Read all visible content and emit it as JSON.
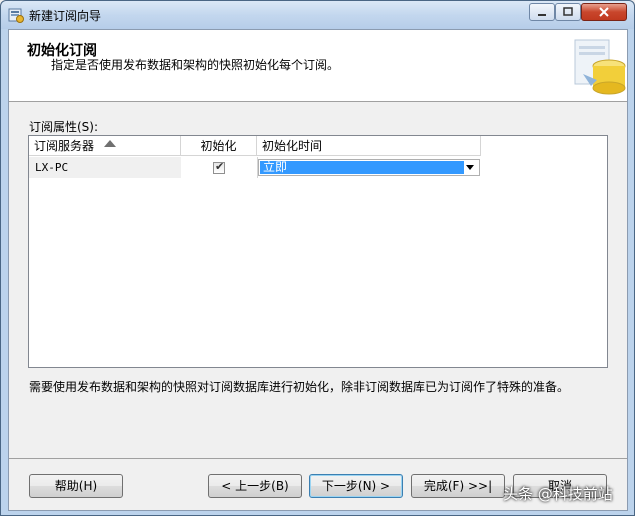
{
  "window": {
    "title": "新建订阅向导"
  },
  "header": {
    "title": "初始化订阅",
    "subtitle": "指定是否使用发布数据和架构的快照初始化每个订阅。"
  },
  "grid": {
    "label": "订阅属性(S):",
    "columns": [
      "订阅服务器",
      "初始化",
      "初始化时间"
    ],
    "rows": [
      {
        "server": "LX-PC",
        "initialize": true,
        "time": "立即"
      }
    ]
  },
  "description": "需要使用发布数据和架构的快照对订阅数据库进行初始化，除非订阅数据库已为订阅作了特殊的准备。",
  "buttons": {
    "help": "帮助(H)",
    "back": "< 上一步(B)",
    "next": "下一步(N) >",
    "finish": "完成(F) >>|",
    "cancel": "取消"
  },
  "watermark": "头条 @科技前站",
  "colors": {
    "selection": "#3399ff",
    "titlebar": "#c3d7ee",
    "close_button": "#c9462c"
  }
}
